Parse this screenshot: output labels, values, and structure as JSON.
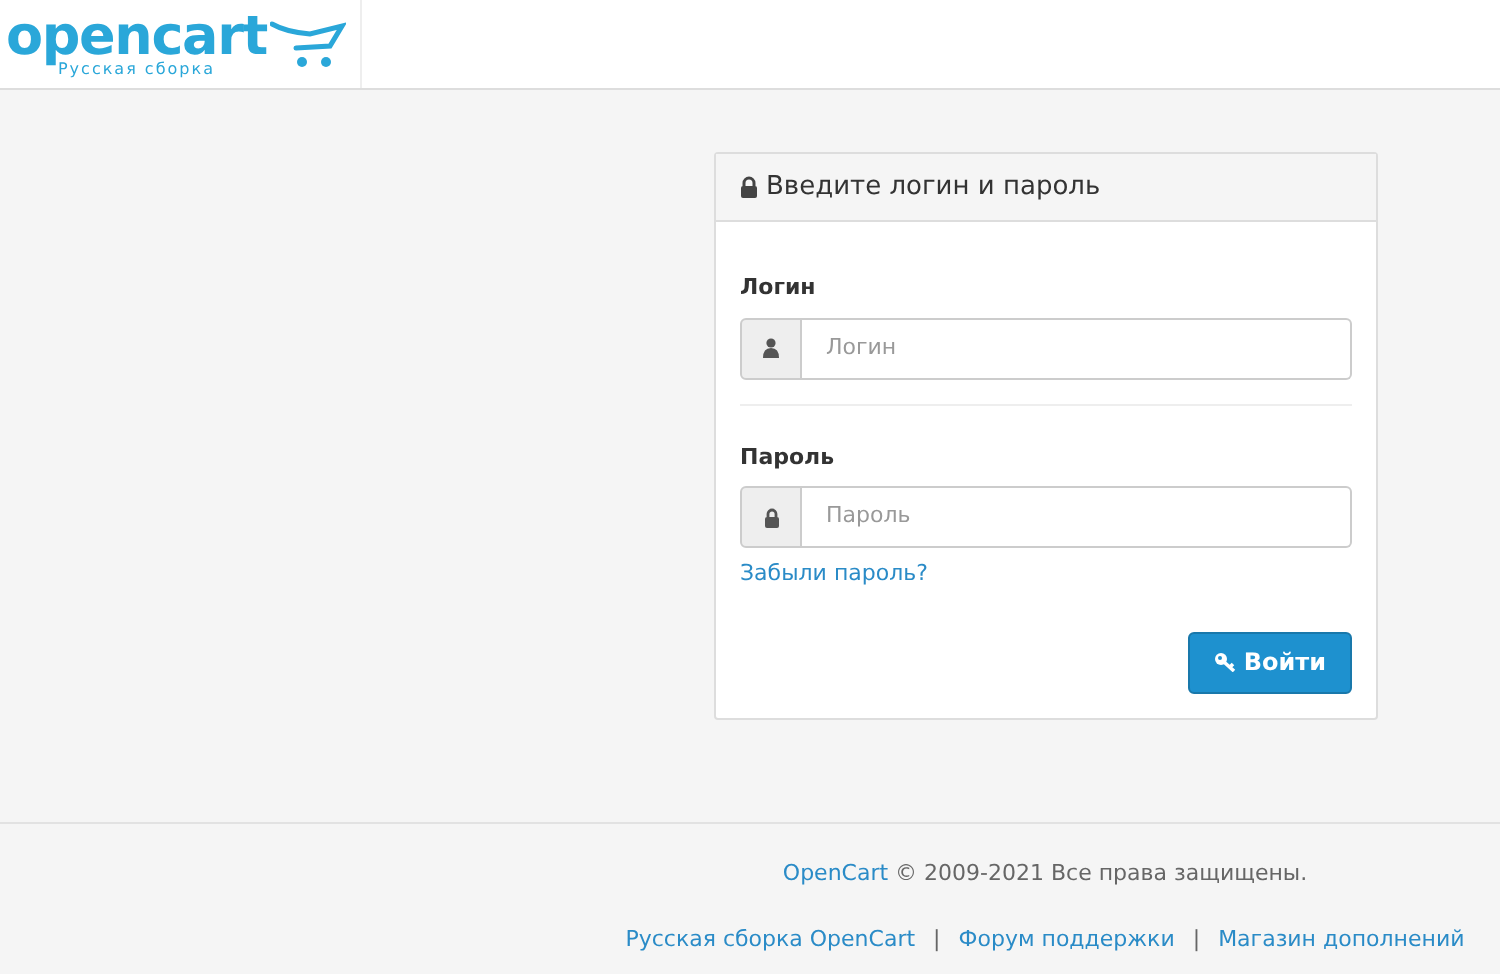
{
  "header": {
    "logo": {
      "name": "opencart",
      "subtitle": "Русская сборка"
    }
  },
  "login_panel": {
    "title": "Введите логин и пароль",
    "fields": [
      {
        "label": "Логин",
        "placeholder": "Логин",
        "kind": "user"
      },
      {
        "label": "Пароль",
        "placeholder": "Пароль",
        "kind": "password"
      }
    ],
    "forgot_link": "Забыли пароль?",
    "submit_button": "Войти"
  },
  "footer": {
    "copyright_link": "OpenCart",
    "copyright_text": " © 2009-2021 Все права защищены.",
    "links": [
      "Русская сборка OpenCart",
      "Форум поддержки",
      "Магазин дополнений"
    ],
    "separator": "|"
  }
}
